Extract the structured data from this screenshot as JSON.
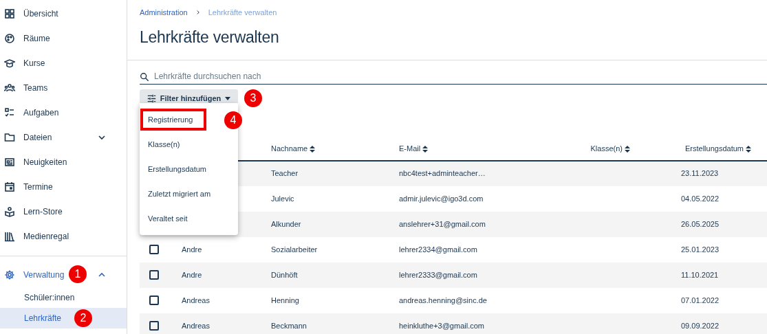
{
  "sidebar": {
    "items": [
      {
        "label": "Übersicht"
      },
      {
        "label": "Räume"
      },
      {
        "label": "Kurse"
      },
      {
        "label": "Teams"
      },
      {
        "label": "Aufgaben"
      },
      {
        "label": "Dateien",
        "expanded": false
      },
      {
        "label": "Neuigkeiten"
      },
      {
        "label": "Termine"
      },
      {
        "label": "Lern-Store"
      },
      {
        "label": "Medienregal"
      }
    ],
    "admin": {
      "label": "Verwaltung",
      "expanded": true,
      "callout": "1",
      "children": [
        {
          "label": "Schüler:innen",
          "selected": false
        },
        {
          "label": "Lehrkräfte",
          "selected": true,
          "callout": "2"
        }
      ]
    }
  },
  "breadcrumb": [
    {
      "label": "Administration"
    },
    {
      "label": "Lehrkräfte verwalten"
    }
  ],
  "title": "Lehrkräfte verwalten",
  "search": {
    "placeholder": "Lehrkräfte durchsuchen nach"
  },
  "filter_button": {
    "label": "Filter hinzufügen",
    "callout": "3"
  },
  "filter_menu": [
    {
      "label": "Registrierung",
      "highlighted": true,
      "callout": "4"
    },
    {
      "label": "Klasse(n)",
      "highlighted": false
    },
    {
      "label": "Erstellungsdatum",
      "highlighted": false
    },
    {
      "label": "Zuletzt migriert am",
      "highlighted": false
    },
    {
      "label": "Veraltet seit",
      "highlighted": false
    }
  ],
  "table": {
    "columns": [
      {
        "label": "Nachname"
      },
      {
        "label": "E-Mail"
      },
      {
        "label": "Klasse(n)"
      },
      {
        "label": "Erstellungsdatum"
      }
    ],
    "rows": [
      {
        "last_name": "Teacher",
        "email": "nbc4test+adminteacher…",
        "created": "23.11.2023"
      },
      {
        "last_name": "Julevic",
        "email": "admir.julevic@igo3d.com",
        "created": "04.05.2022"
      },
      {
        "last_name": "Alkunder",
        "email": "anslehrer+31@gmail.com",
        "created": "26.05.2025"
      },
      {
        "checked": false,
        "first_name": "Andre",
        "last_name": "Sozialarbeiter",
        "email": "lehrer2334@gmail.com",
        "created": "25.01.2023"
      },
      {
        "checked": false,
        "first_name": "Andre",
        "last_name": "Dünhöft",
        "email": "lehrer2333@gmail.com",
        "created": "11.10.2021"
      },
      {
        "checked": false,
        "first_name": "Andreas",
        "last_name": "Henning",
        "email": "andreas.henning@sinc.de",
        "created": "07.01.2022"
      },
      {
        "checked": false,
        "first_name": "Andreas",
        "last_name": "Beckmann",
        "email": "heinkluthe+3@gmail.com",
        "created": "09.09.2022"
      }
    ]
  }
}
